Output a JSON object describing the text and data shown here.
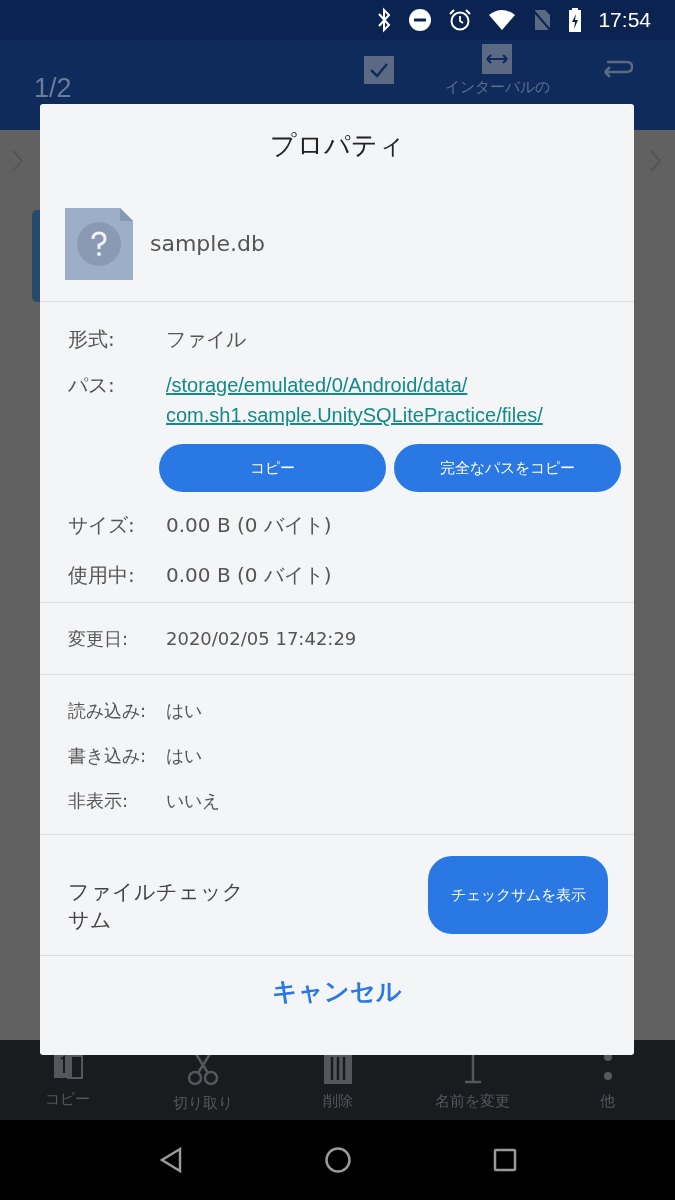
{
  "status_bar": {
    "time": "17:54"
  },
  "app_bar": {
    "counter": "1/2",
    "interval_label": "インターバルの"
  },
  "dialog": {
    "title": "プロパティ",
    "file_name": "sample.db",
    "type": {
      "label": "形式:",
      "value": "ファイル"
    },
    "path": {
      "label": "パス:",
      "value": "/storage/emulated/0/Android/data/com.sh1.sample.UnitySQLitePractice/files/"
    },
    "path_buttons": [
      "コピー",
      "完全なパスをコピー"
    ],
    "sizes": [
      {
        "label": "サイズ:",
        "value": "0.00 B (0 バイト)"
      },
      {
        "label": "使用中:",
        "value": "0.00 B (0 バイト)"
      }
    ],
    "modified": {
      "label": "変更日:",
      "value": "2020/02/05 17:42:29"
    },
    "attributes": [
      {
        "label": "読み込み:",
        "value": "はい"
      },
      {
        "label": "書き込み:",
        "value": "はい"
      },
      {
        "label": "非表示:",
        "value": "いいえ"
      }
    ],
    "checksum": {
      "label": "ファイルチェックサム",
      "button": "チェックサムを表示"
    },
    "cancel": "キャンセル"
  },
  "bottom_toolbar": [
    {
      "label": "コピー"
    },
    {
      "label": "切り取り"
    },
    {
      "label": "削除"
    },
    {
      "label": "名前を変更"
    },
    {
      "label": "他"
    }
  ]
}
